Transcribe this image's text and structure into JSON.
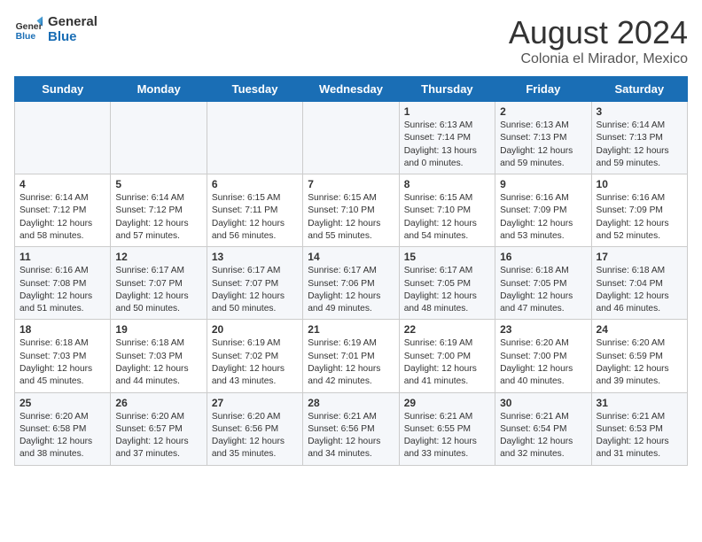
{
  "logo": {
    "line1": "General",
    "line2": "Blue"
  },
  "title": "August 2024",
  "subtitle": "Colonia el Mirador, Mexico",
  "days_of_week": [
    "Sunday",
    "Monday",
    "Tuesday",
    "Wednesday",
    "Thursday",
    "Friday",
    "Saturday"
  ],
  "weeks": [
    [
      {
        "day": "",
        "content": ""
      },
      {
        "day": "",
        "content": ""
      },
      {
        "day": "",
        "content": ""
      },
      {
        "day": "",
        "content": ""
      },
      {
        "day": "1",
        "content": "Sunrise: 6:13 AM\nSunset: 7:14 PM\nDaylight: 13 hours\nand 0 minutes."
      },
      {
        "day": "2",
        "content": "Sunrise: 6:13 AM\nSunset: 7:13 PM\nDaylight: 12 hours\nand 59 minutes."
      },
      {
        "day": "3",
        "content": "Sunrise: 6:14 AM\nSunset: 7:13 PM\nDaylight: 12 hours\nand 59 minutes."
      }
    ],
    [
      {
        "day": "4",
        "content": "Sunrise: 6:14 AM\nSunset: 7:12 PM\nDaylight: 12 hours\nand 58 minutes."
      },
      {
        "day": "5",
        "content": "Sunrise: 6:14 AM\nSunset: 7:12 PM\nDaylight: 12 hours\nand 57 minutes."
      },
      {
        "day": "6",
        "content": "Sunrise: 6:15 AM\nSunset: 7:11 PM\nDaylight: 12 hours\nand 56 minutes."
      },
      {
        "day": "7",
        "content": "Sunrise: 6:15 AM\nSunset: 7:10 PM\nDaylight: 12 hours\nand 55 minutes."
      },
      {
        "day": "8",
        "content": "Sunrise: 6:15 AM\nSunset: 7:10 PM\nDaylight: 12 hours\nand 54 minutes."
      },
      {
        "day": "9",
        "content": "Sunrise: 6:16 AM\nSunset: 7:09 PM\nDaylight: 12 hours\nand 53 minutes."
      },
      {
        "day": "10",
        "content": "Sunrise: 6:16 AM\nSunset: 7:09 PM\nDaylight: 12 hours\nand 52 minutes."
      }
    ],
    [
      {
        "day": "11",
        "content": "Sunrise: 6:16 AM\nSunset: 7:08 PM\nDaylight: 12 hours\nand 51 minutes."
      },
      {
        "day": "12",
        "content": "Sunrise: 6:17 AM\nSunset: 7:07 PM\nDaylight: 12 hours\nand 50 minutes."
      },
      {
        "day": "13",
        "content": "Sunrise: 6:17 AM\nSunset: 7:07 PM\nDaylight: 12 hours\nand 50 minutes."
      },
      {
        "day": "14",
        "content": "Sunrise: 6:17 AM\nSunset: 7:06 PM\nDaylight: 12 hours\nand 49 minutes."
      },
      {
        "day": "15",
        "content": "Sunrise: 6:17 AM\nSunset: 7:05 PM\nDaylight: 12 hours\nand 48 minutes."
      },
      {
        "day": "16",
        "content": "Sunrise: 6:18 AM\nSunset: 7:05 PM\nDaylight: 12 hours\nand 47 minutes."
      },
      {
        "day": "17",
        "content": "Sunrise: 6:18 AM\nSunset: 7:04 PM\nDaylight: 12 hours\nand 46 minutes."
      }
    ],
    [
      {
        "day": "18",
        "content": "Sunrise: 6:18 AM\nSunset: 7:03 PM\nDaylight: 12 hours\nand 45 minutes."
      },
      {
        "day": "19",
        "content": "Sunrise: 6:18 AM\nSunset: 7:03 PM\nDaylight: 12 hours\nand 44 minutes."
      },
      {
        "day": "20",
        "content": "Sunrise: 6:19 AM\nSunset: 7:02 PM\nDaylight: 12 hours\nand 43 minutes."
      },
      {
        "day": "21",
        "content": "Sunrise: 6:19 AM\nSunset: 7:01 PM\nDaylight: 12 hours\nand 42 minutes."
      },
      {
        "day": "22",
        "content": "Sunrise: 6:19 AM\nSunset: 7:00 PM\nDaylight: 12 hours\nand 41 minutes."
      },
      {
        "day": "23",
        "content": "Sunrise: 6:20 AM\nSunset: 7:00 PM\nDaylight: 12 hours\nand 40 minutes."
      },
      {
        "day": "24",
        "content": "Sunrise: 6:20 AM\nSunset: 6:59 PM\nDaylight: 12 hours\nand 39 minutes."
      }
    ],
    [
      {
        "day": "25",
        "content": "Sunrise: 6:20 AM\nSunset: 6:58 PM\nDaylight: 12 hours\nand 38 minutes."
      },
      {
        "day": "26",
        "content": "Sunrise: 6:20 AM\nSunset: 6:57 PM\nDaylight: 12 hours\nand 37 minutes."
      },
      {
        "day": "27",
        "content": "Sunrise: 6:20 AM\nSunset: 6:56 PM\nDaylight: 12 hours\nand 35 minutes."
      },
      {
        "day": "28",
        "content": "Sunrise: 6:21 AM\nSunset: 6:56 PM\nDaylight: 12 hours\nand 34 minutes."
      },
      {
        "day": "29",
        "content": "Sunrise: 6:21 AM\nSunset: 6:55 PM\nDaylight: 12 hours\nand 33 minutes."
      },
      {
        "day": "30",
        "content": "Sunrise: 6:21 AM\nSunset: 6:54 PM\nDaylight: 12 hours\nand 32 minutes."
      },
      {
        "day": "31",
        "content": "Sunrise: 6:21 AM\nSunset: 6:53 PM\nDaylight: 12 hours\nand 31 minutes."
      }
    ]
  ]
}
